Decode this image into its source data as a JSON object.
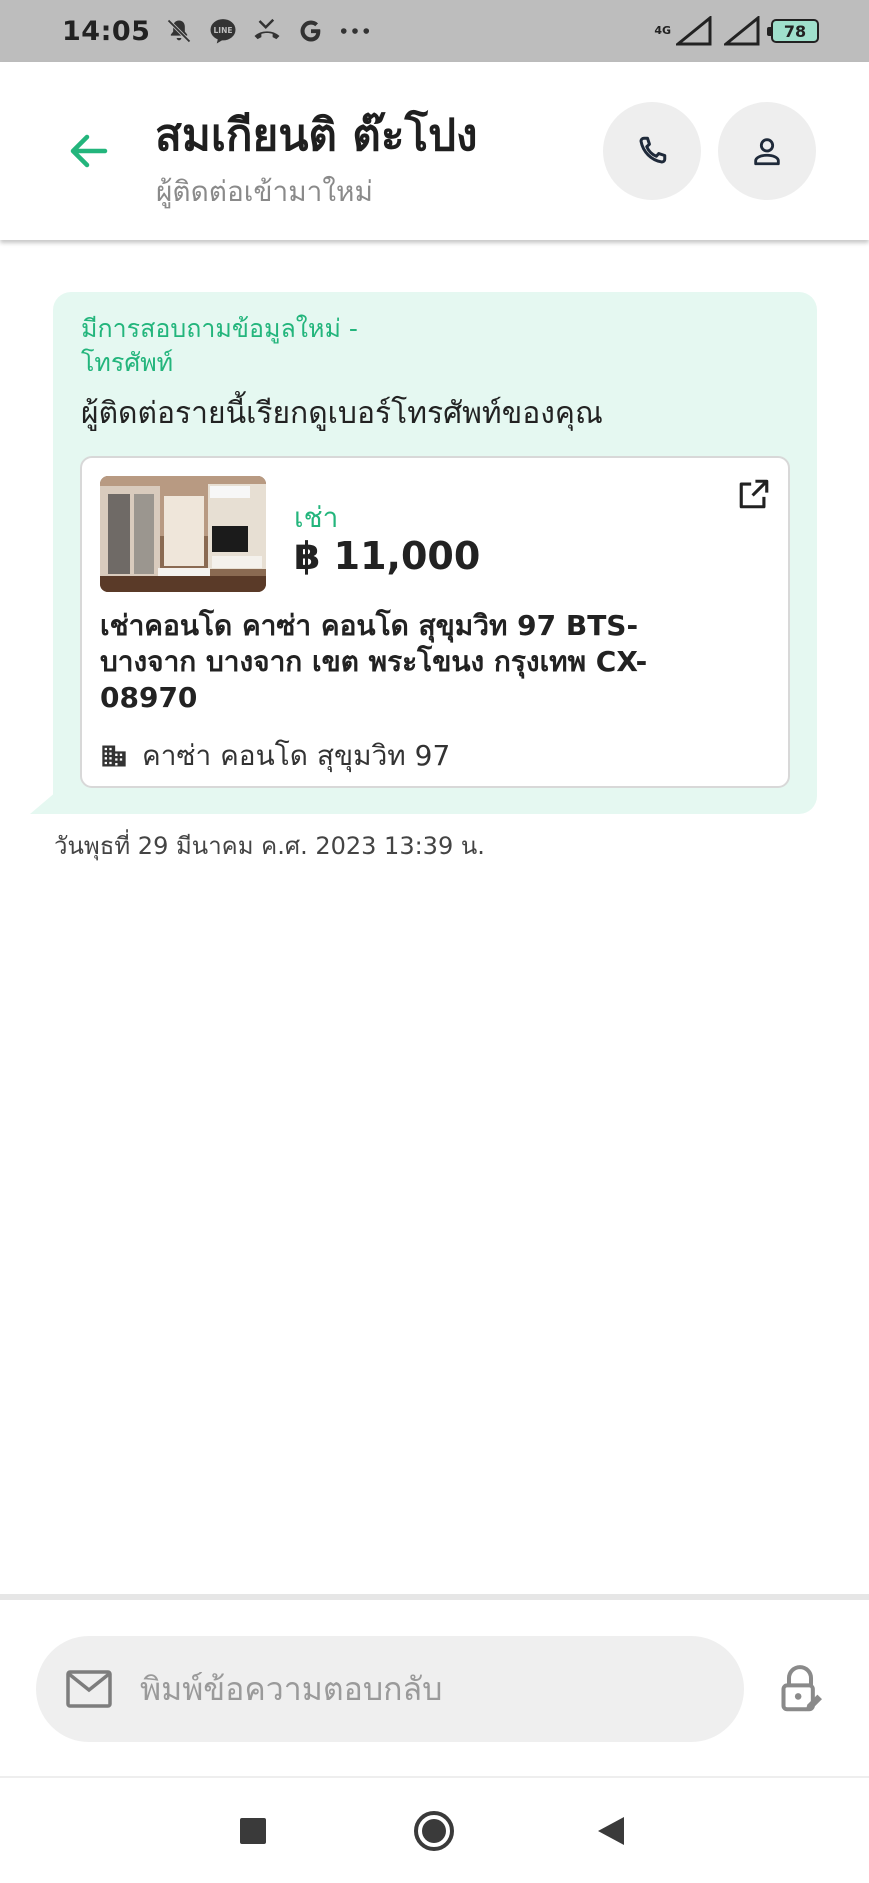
{
  "status_bar": {
    "time": "14:05",
    "notification_icons": [
      "muted-bell-icon",
      "line-app-icon",
      "missed-call-icon",
      "google-icon",
      "more-dots-icon"
    ],
    "network_label": "4G",
    "battery_level": "78"
  },
  "header": {
    "contact_name": "สมเกียนติ ต๊ะโปง",
    "contact_subtitle": "ผู้ติดต่อเข้ามาใหม่",
    "accent_color": "#23b57c"
  },
  "message": {
    "title": "มีการสอบถามข้อมูลใหม่ - โทรศัพท์",
    "body": "ผู้ติดต่อรายนี้เรียกดูเบอร์โทรศัพท์ของคุณ",
    "listing": {
      "type": "เช่า",
      "price": "฿ 11,000",
      "title": "เช่าคอนโด  คาซ่า คอนโด สุขุมวิท 97 BTS- บางจาก บางจาก เขต พระโขนง กรุงเทพ CX-08970",
      "project": "คาซ่า คอนโด สุขุมวิท 97"
    },
    "timestamp": "วันพุธที่ 29 มีนาคม ค.ศ. 2023 13:39 น."
  },
  "composer": {
    "placeholder": "พิมพ์ข้อความตอบกลับ"
  },
  "nav_bar": {
    "buttons": [
      "recents-square-icon",
      "home-circle-icon",
      "back-triangle-icon"
    ]
  }
}
